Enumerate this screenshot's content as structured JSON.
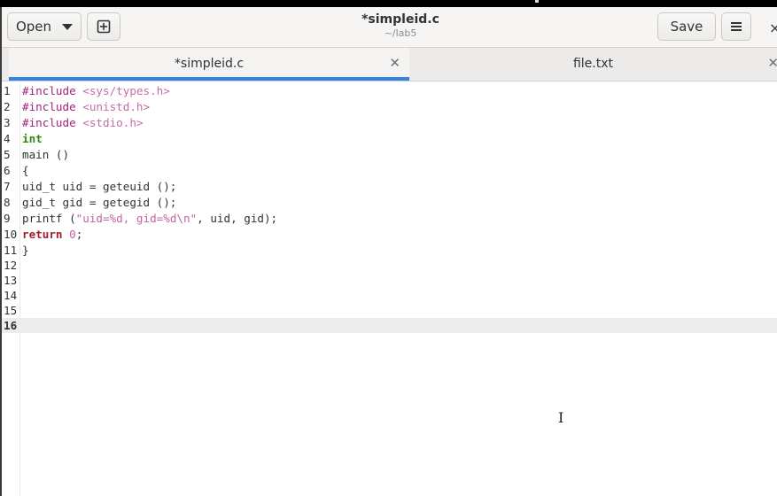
{
  "header": {
    "open_label": "Open",
    "title": "*simpleid.c",
    "subtitle": "~/lab5",
    "save_label": "Save"
  },
  "tabs": [
    {
      "label": "*simpleid.c",
      "active": true
    },
    {
      "label": "file.txt",
      "active": false
    }
  ],
  "icons": {
    "new_document": "new-document-icon",
    "menu": "hamburger-menu-icon",
    "close": "close-icon",
    "dropdown": "chevron-down-icon"
  },
  "colors": {
    "accent": "#3584e4",
    "keyword": "#a51d2d",
    "type": "#2e8c0e",
    "preprocessor": "#a2227a",
    "string": "#c066a6"
  },
  "editor": {
    "current_line": 16,
    "lines": [
      {
        "n": "1",
        "tokens": [
          {
            "t": "#include ",
            "c": "pp"
          },
          {
            "t": "<sys/types.h>",
            "c": "inc"
          }
        ]
      },
      {
        "n": "2",
        "tokens": [
          {
            "t": "#include ",
            "c": "pp"
          },
          {
            "t": "<unistd.h>",
            "c": "inc"
          }
        ]
      },
      {
        "n": "3",
        "tokens": [
          {
            "t": "#include ",
            "c": "pp"
          },
          {
            "t": "<stdio.h>",
            "c": "inc"
          }
        ]
      },
      {
        "n": "4",
        "tokens": [
          {
            "t": "int",
            "c": "typ"
          }
        ]
      },
      {
        "n": "5",
        "tokens": [
          {
            "t": "main ()",
            "c": ""
          }
        ]
      },
      {
        "n": "6",
        "tokens": [
          {
            "t": "{",
            "c": ""
          }
        ]
      },
      {
        "n": "7",
        "tokens": [
          {
            "t": "uid_t uid = geteuid ();",
            "c": ""
          }
        ]
      },
      {
        "n": "8",
        "tokens": [
          {
            "t": "gid_t gid = getegid ();",
            "c": ""
          }
        ]
      },
      {
        "n": "9",
        "tokens": [
          {
            "t": "printf (",
            "c": ""
          },
          {
            "t": "\"uid=%d, gid=%d\\n\"",
            "c": "str"
          },
          {
            "t": ", uid, gid);",
            "c": ""
          }
        ]
      },
      {
        "n": "10",
        "tokens": [
          {
            "t": "return",
            "c": "kw"
          },
          {
            "t": " ",
            "c": ""
          },
          {
            "t": "0",
            "c": "num"
          },
          {
            "t": ";",
            "c": ""
          }
        ]
      },
      {
        "n": "11",
        "tokens": [
          {
            "t": "}",
            "c": ""
          }
        ]
      },
      {
        "n": "12",
        "tokens": []
      },
      {
        "n": "13",
        "tokens": []
      },
      {
        "n": "14",
        "tokens": []
      },
      {
        "n": "15",
        "tokens": []
      },
      {
        "n": "16",
        "tokens": []
      }
    ]
  }
}
